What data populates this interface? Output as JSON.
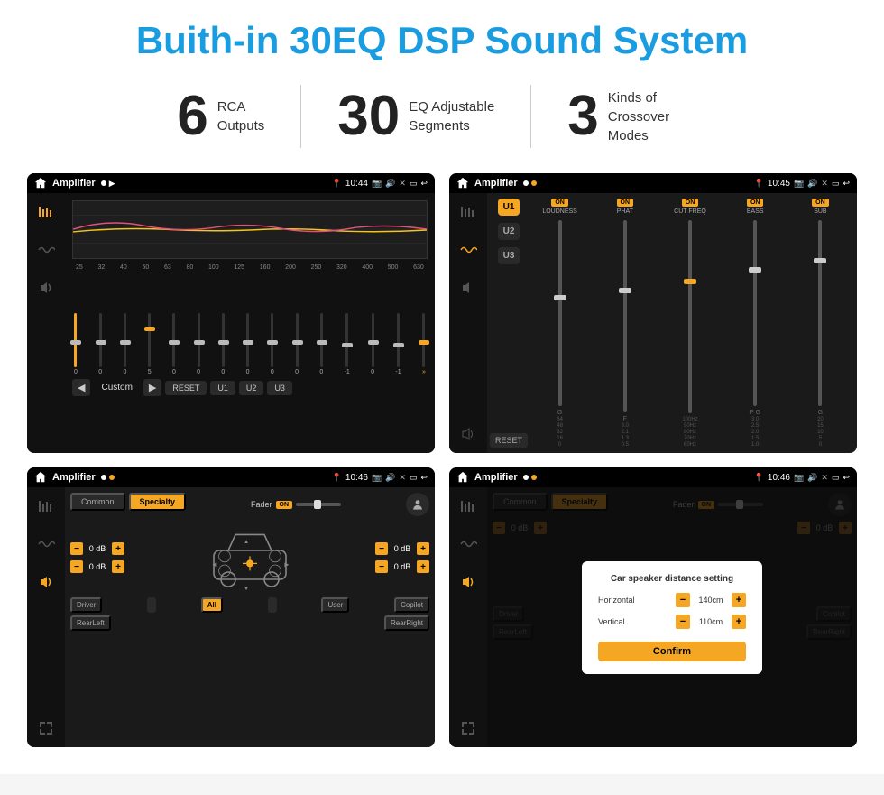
{
  "page": {
    "title": "Buith-in 30EQ DSP Sound System",
    "background": "#ffffff"
  },
  "stats": [
    {
      "number": "6",
      "label": "RCA\nOutputs"
    },
    {
      "number": "30",
      "label": "EQ Adjustable\nSegments"
    },
    {
      "number": "3",
      "label": "Kinds of\nCrossover Modes"
    }
  ],
  "screens": [
    {
      "id": "eq-screen",
      "status_bar": {
        "title": "Amplifier",
        "time": "10:44"
      },
      "type": "equalizer"
    },
    {
      "id": "crossover-screen",
      "status_bar": {
        "title": "Amplifier",
        "time": "10:45"
      },
      "type": "crossover"
    },
    {
      "id": "fader-screen",
      "status_bar": {
        "title": "Amplifier",
        "time": "10:46"
      },
      "type": "fader"
    },
    {
      "id": "dialog-screen",
      "status_bar": {
        "title": "Amplifier",
        "time": "10:46"
      },
      "type": "dialog"
    }
  ],
  "eq": {
    "freqs": [
      "25",
      "32",
      "40",
      "50",
      "63",
      "80",
      "100",
      "125",
      "160",
      "200",
      "250",
      "320",
      "400",
      "500",
      "630"
    ],
    "values": [
      "0",
      "0",
      "0",
      "5",
      "0",
      "0",
      "0",
      "0",
      "0",
      "0",
      "0",
      "-1",
      "0",
      "-1"
    ],
    "buttons": [
      "Custom",
      "RESET",
      "U1",
      "U2",
      "U3"
    ],
    "preset_label": "Custom"
  },
  "crossover": {
    "u_buttons": [
      "U1",
      "U2",
      "U3"
    ],
    "channels": [
      {
        "name": "LOUDNESS",
        "on": true
      },
      {
        "name": "PHAT",
        "on": true
      },
      {
        "name": "CUT FREQ",
        "on": true
      },
      {
        "name": "BASS",
        "on": true
      },
      {
        "name": "SUB",
        "on": true
      }
    ],
    "reset_label": "RESET"
  },
  "fader": {
    "tabs": [
      "Common",
      "Specialty"
    ],
    "active_tab": "Specialty",
    "fader_label": "Fader",
    "fader_on": "ON",
    "db_values": {
      "front_left": "0 dB",
      "front_right": "0 dB",
      "rear_left": "0 dB",
      "rear_right": "0 dB"
    },
    "bottom_labels": [
      "Driver",
      "All",
      "User",
      "RearLeft",
      "Copilot",
      "RearRight"
    ]
  },
  "dialog": {
    "title": "Car speaker distance setting",
    "horizontal_label": "Horizontal",
    "horizontal_value": "140cm",
    "vertical_label": "Vertical",
    "vertical_value": "110cm",
    "confirm_label": "Confirm",
    "db_right": "0 dB"
  }
}
